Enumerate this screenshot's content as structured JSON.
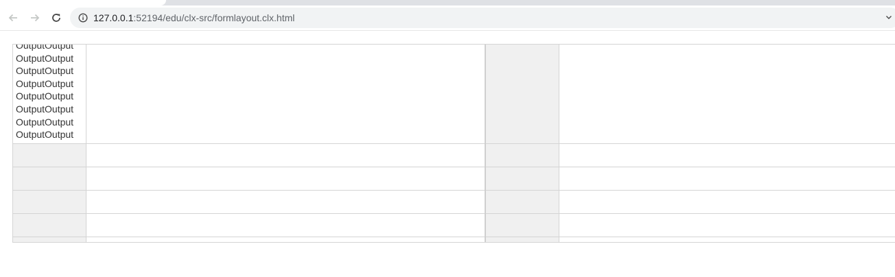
{
  "browser": {
    "url": {
      "host": "127.0.0.1",
      "path": ":52194/edu/clx-src/formlayout.clx.html"
    },
    "icons": {
      "back": "arrow-left-icon",
      "forward": "arrow-right-icon",
      "reload": "reload-icon",
      "site_info": "info-icon"
    }
  },
  "form": {
    "output_lines": [
      "OutputOutput",
      "OutputOutput",
      "OutputOutput",
      "OutputOutput",
      "OutputOutput",
      "OutputOutput",
      "OutputOutput",
      "OutputOutput"
    ],
    "colors": {
      "label_bg": "#f0f0f0",
      "grid": "#d4d4d4",
      "text": "#333333"
    }
  }
}
